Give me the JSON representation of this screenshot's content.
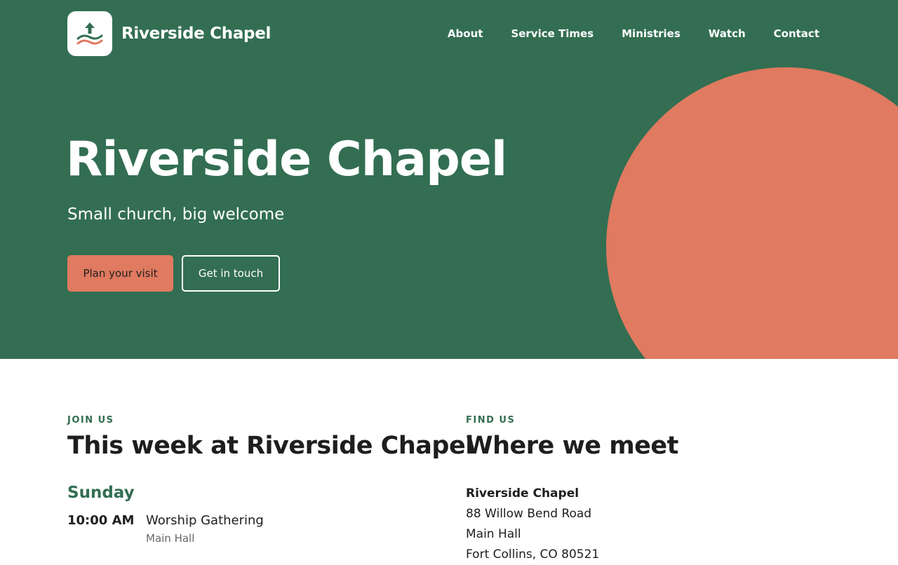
{
  "brand": {
    "name": "Riverside Chapel",
    "logo_icon": "river-arrow-logo-icon"
  },
  "nav": {
    "items": [
      "About",
      "Service Times",
      "Ministries",
      "Watch",
      "Contact"
    ]
  },
  "hero": {
    "title": "Riverside Chapel",
    "subtitle": "Small church, big welcome",
    "primary_button": "Plan your visit",
    "secondary_button": "Get in touch"
  },
  "schedule": {
    "eyebrow": "JOIN US",
    "title": "This week at Riverside Chapel",
    "day": "Sunday",
    "events": [
      {
        "time": "10:00 AM",
        "name": "Worship Gathering",
        "location": "Main Hall"
      }
    ]
  },
  "location": {
    "eyebrow": "FIND US",
    "title": "Where we meet",
    "lines": [
      "Riverside Chapel",
      "88 Willow Bend Road",
      "Main Hall",
      "Fort Collins, CO 80521"
    ]
  },
  "colors": {
    "brand_green": "#336e52",
    "accent_coral": "#e07a60",
    "text_dark": "#1e1e1e",
    "white": "#ffffff"
  }
}
